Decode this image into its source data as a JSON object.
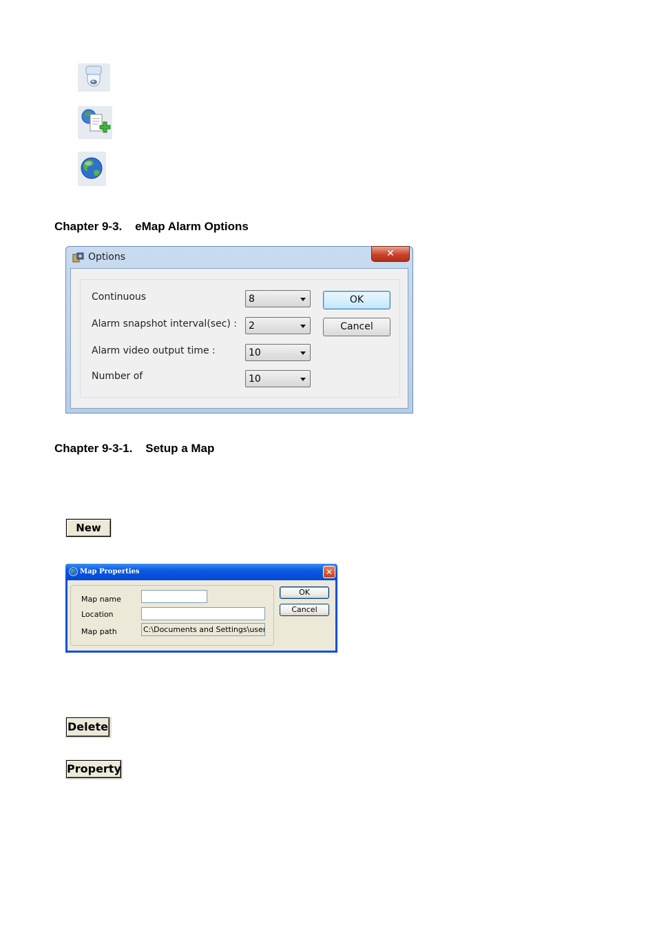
{
  "icons": [
    {
      "name": "camera-icon"
    },
    {
      "name": "add-map-icon"
    },
    {
      "name": "globe-icon"
    }
  ],
  "headings": {
    "alarm_options": "Chapter 9-3.    eMap Alarm Options",
    "setup_map": "Chapter 9-3-1.    Setup a Map"
  },
  "options_dialog": {
    "title": "Options",
    "close": "✕",
    "rows": [
      {
        "label": "Continuous",
        "value": "8"
      },
      {
        "label": "Alarm snapshot interval(sec) :",
        "value": "2"
      },
      {
        "label": "Alarm video output time :",
        "value": "10"
      },
      {
        "label": "Number of",
        "value": "10"
      }
    ],
    "ok": "OK",
    "cancel": "Cancel"
  },
  "buttons": {
    "new": "New",
    "delete": "Delete",
    "property": "Property"
  },
  "map_dialog": {
    "title": "Map Properties",
    "close": "✕",
    "fields": {
      "map_name_label": "Map name",
      "map_name_value": "",
      "location_label": "Location",
      "location_value": "",
      "map_path_label": "Map path",
      "map_path_value": "C:\\Documents and Settings\\user"
    },
    "ok": "OK",
    "cancel": "Cancel"
  }
}
